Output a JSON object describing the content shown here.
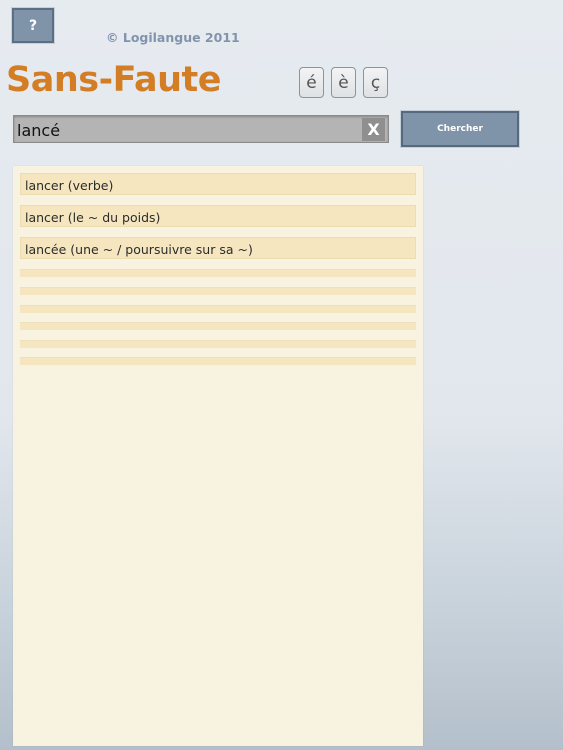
{
  "header": {
    "help_label": "?",
    "copyright": "© Logilangue 2011",
    "app_title": "Sans-Faute"
  },
  "accent_keys": [
    "é",
    "è",
    "ç"
  ],
  "search": {
    "value": "lancé",
    "clear_label": "X",
    "button_label": "Chercher"
  },
  "results": [
    "lancer (verbe)",
    "lancer (le ~ du poids)",
    "lancée (une ~ / poursuivre sur sa ~)"
  ]
}
